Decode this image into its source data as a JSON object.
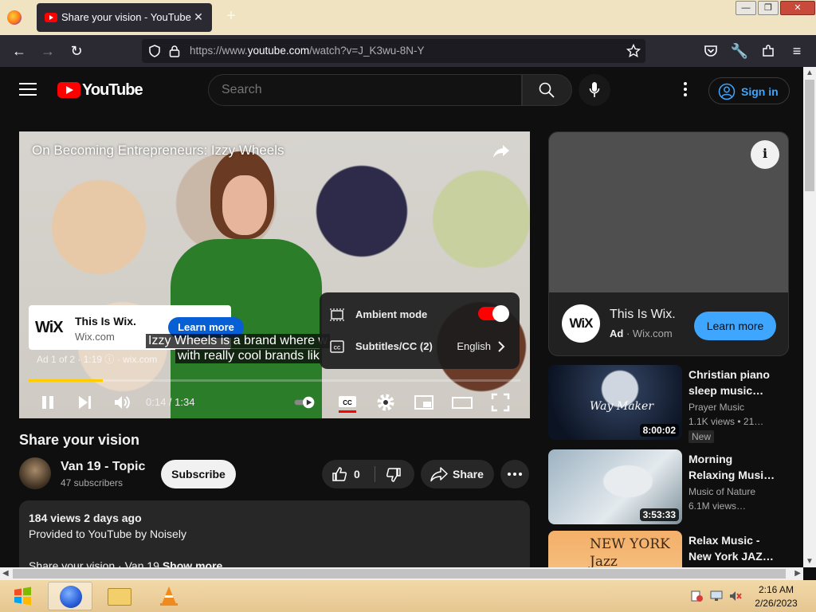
{
  "browser": {
    "tab_title": "Share your vision - YouTube",
    "url_prefix": "https://www.",
    "url_domain": "youtube.com",
    "url_path": "/watch?v=J_K3wu-8N-Y"
  },
  "header": {
    "logo_text": "YouTube",
    "search_placeholder": "Search",
    "signin_label": "Sign in"
  },
  "player": {
    "title": "On Becoming Entrepreneurs: Izzy Wheels",
    "ad_name": "This Is Wix.",
    "ad_domain": "Wix.com",
    "ad_logo": "WiX",
    "learn_more": "Learn more",
    "subtitle_line1": "Izzy Wheels is a brand where w",
    "subtitle_line2": "with really cool brands lik",
    "ad_info": "Ad 1 of 2 · 1:19",
    "ad_info_domain": "wix.com",
    "time": "0:14 / 1:34",
    "progress": 0.15,
    "settings": {
      "ambient_label": "Ambient mode",
      "ambient_on": true,
      "subtitles_label": "Subtitles/CC (2)",
      "subtitles_value": "English"
    }
  },
  "video": {
    "title": "Share your vision",
    "channel": "Van 19 - Topic",
    "subscribers": "47 subscribers",
    "subscribe_label": "Subscribe",
    "likes": "0",
    "share_label": "Share",
    "stats": "184 views  2 days ago",
    "provided_by": "Provided to YouTube by Noisely",
    "desc_line": "Share your vision · Van 19",
    "show_more": "Show more"
  },
  "ad_panel": {
    "logo": "WiX",
    "title": "This Is Wix.",
    "ad_label": "Ad",
    "domain": "Wix.com",
    "learn_more": "Learn more",
    "info": "i"
  },
  "recommendations": [
    {
      "title": "Christian piano sleep music…",
      "channel": "Prayer Music",
      "meta": "1.1K views  • 21…",
      "badge": "New",
      "duration": "8:00:02",
      "thumb_text": "Way Maker"
    },
    {
      "title": "Morning Relaxing Musi…",
      "channel": "Music of Nature",
      "meta": "6.1M views…",
      "badge": "",
      "duration": "3:53:33",
      "thumb_text": ""
    },
    {
      "title": "Relax Music - New York JAZ…",
      "channel": "",
      "meta": "",
      "badge": "",
      "duration": "",
      "thumb_text": "NEW YORK Jazz"
    }
  ],
  "taskbar": {
    "time": "2:16 AM",
    "date": "2/26/2023"
  }
}
